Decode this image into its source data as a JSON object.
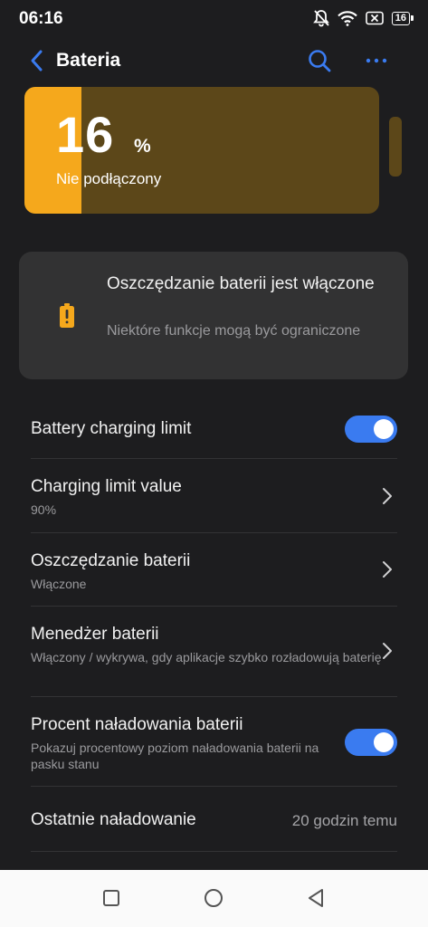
{
  "status": {
    "time": "06:16",
    "battery": "16"
  },
  "header": {
    "title": "Bateria"
  },
  "battery": {
    "level": "16",
    "unit": "%",
    "state": "Nie podłączony",
    "fill_fraction": 0.16
  },
  "saver_card": {
    "title": "Oszczędzanie baterii jest włączone",
    "subtitle": "Niektóre funkcje mogą być ograniczone"
  },
  "settings": {
    "charging_limit": {
      "label": "Battery charging limit",
      "enabled": true
    },
    "limit_value": {
      "label": "Charging limit value",
      "value": "90%"
    },
    "saver": {
      "label": "Oszczędzanie baterii",
      "value": "Włączone"
    },
    "manager": {
      "label": "Menedżer baterii",
      "value": "Włączony / wykrywa, gdy aplikacje szybko rozładowują baterię"
    },
    "percent": {
      "label": "Procent naładowania baterii",
      "value": "Pokazuj procentowy poziom naładowania baterii na pasku stanu",
      "enabled": true
    },
    "last_charge": {
      "label": "Ostatnie naładowanie",
      "value": "20 godzin temu"
    }
  },
  "colors": {
    "accent": "#3a7bf0",
    "battery_fill": "#f5a81c",
    "battery_empty": "#5c4719",
    "background": "#1d1d1f",
    "card": "#323233"
  },
  "icons": [
    "bell-off-icon",
    "wifi-icon",
    "sim-off-icon",
    "battery-icon",
    "back-arrow-icon",
    "search-icon",
    "more-icon",
    "battery-saver-icon",
    "chevron-right-icon",
    "square-icon",
    "circle-icon",
    "triangle-back-icon"
  ]
}
